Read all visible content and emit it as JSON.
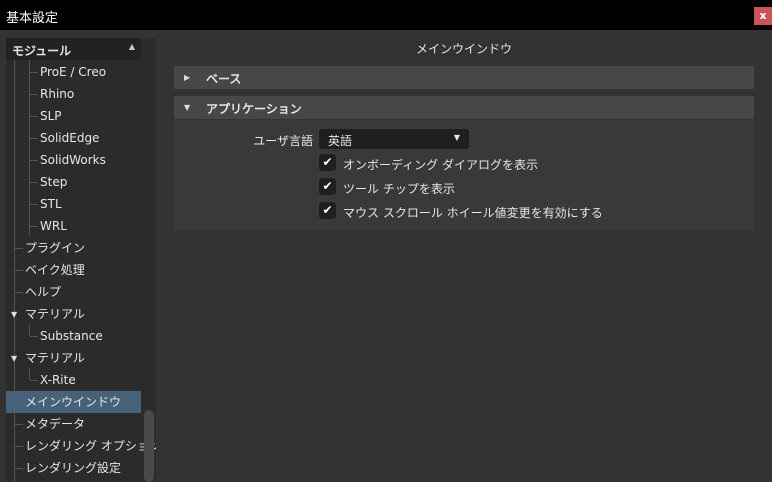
{
  "window": {
    "title": "基本設定",
    "close": "x"
  },
  "sidebar": {
    "header": "モジュール",
    "items": [
      "ProE / Creo",
      "Rhino",
      "SLP",
      "SolidEdge",
      "SolidWorks",
      "Step",
      "STL",
      "WRL",
      "プラグイン",
      "ベイク処理",
      "ヘルプ",
      "マテリアル",
      "Substance",
      "マテリアル",
      "X-Rite",
      "メインウインドウ",
      "メタデータ",
      "レンダリング オプション",
      "レンダリング設定"
    ],
    "selected": "メインウインドウ"
  },
  "main": {
    "title": "メインウインドウ",
    "sections": [
      {
        "label": "ベース",
        "expanded": false
      },
      {
        "label": "アプリケーション",
        "expanded": true
      }
    ],
    "language_label": "ユーザ言語",
    "language_value": "英語",
    "checkboxes": [
      {
        "label": "オンボーディング ダイアログを表示",
        "checked": true
      },
      {
        "label": "ツール チップを表示",
        "checked": true
      },
      {
        "label": "マウス スクロール ホイール値変更を有効にする",
        "checked": true
      }
    ]
  }
}
